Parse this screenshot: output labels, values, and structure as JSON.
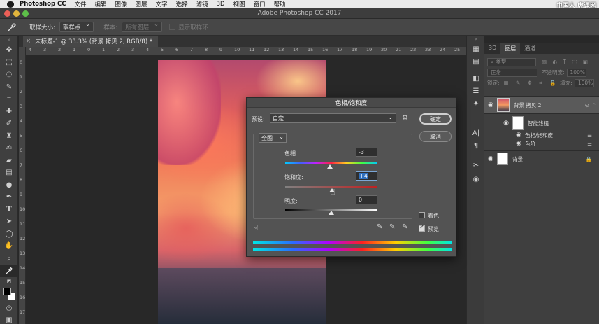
{
  "menubar": {
    "app": "Photoshop CC",
    "items": [
      "文件",
      "编辑",
      "图像",
      "图层",
      "文字",
      "选择",
      "滤镜",
      "3D",
      "视图",
      "窗口",
      "帮助"
    ],
    "watermark": "中国人 虎课网"
  },
  "titlebar": {
    "title": "Adobe Photoshop CC 2017"
  },
  "options": {
    "sample_size_label": "取样大小:",
    "sample_size_value": "取样点",
    "sample_label": "样本:",
    "sample_value": "所有图层",
    "show_ring_label": "显示取样环"
  },
  "document": {
    "tab_title": "未标题-1 @ 33.3% (背景 拷贝 2, RGB/8) *"
  },
  "ruler_top": [
    "4",
    "3",
    "2",
    "1",
    "0",
    "1",
    "2",
    "3",
    "4",
    "5",
    "6",
    "7",
    "8",
    "9",
    "10",
    "11",
    "12",
    "13",
    "14",
    "15",
    "16",
    "17",
    "18",
    "19",
    "20",
    "21",
    "22",
    "23",
    "24",
    "25",
    "26"
  ],
  "ruler_left": [
    "0",
    "1",
    "2",
    "3",
    "4",
    "5",
    "6",
    "7",
    "8",
    "9",
    "10",
    "11",
    "12",
    "13",
    "14",
    "15",
    "16",
    "17"
  ],
  "layers_panel": {
    "tabs": [
      "3D",
      "图层",
      "通道"
    ],
    "kind_label": "类型",
    "blend_mode": "正常",
    "opacity_label": "不透明度:",
    "opacity_value": "100%",
    "lock_label": "锁定:",
    "fill_label": "填充:",
    "fill_value": "100%",
    "layers": [
      {
        "name": "背景 拷贝 2"
      },
      {
        "name": "智能滤镜"
      },
      {
        "name": "色相/饱和度"
      },
      {
        "name": "色阶"
      },
      {
        "name": "背景"
      }
    ]
  },
  "dialog": {
    "title": "色相/饱和度",
    "preset_label": "预设:",
    "preset_value": "自定",
    "channel_value": "全图",
    "hue_label": "色相:",
    "hue_value": "-3",
    "saturation_label": "饱和度:",
    "saturation_value": "+4",
    "lightness_label": "明度:",
    "lightness_value": "0",
    "colorize_label": "着色",
    "colorize_checked": false,
    "preview_label": "预览",
    "preview_checked": true,
    "ok_label": "确定",
    "cancel_label": "取消"
  }
}
